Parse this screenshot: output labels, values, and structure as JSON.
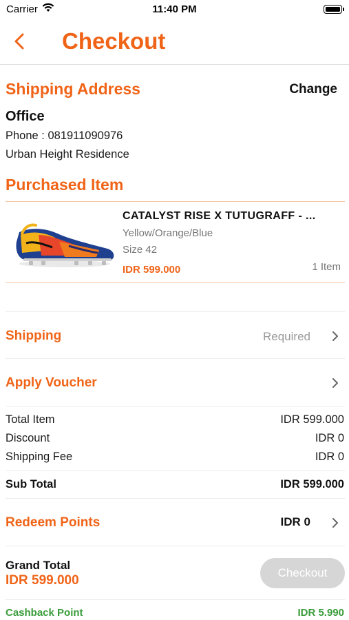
{
  "status_bar": {
    "carrier": "Carrier",
    "time": "11:40 PM",
    "icons": [
      "wifi-icon",
      "battery-icon"
    ]
  },
  "nav": {
    "title": "Checkout",
    "back_icon": "chevron-left-icon"
  },
  "colors": {
    "accent": "#f06418",
    "cashback": "#3a9c3a",
    "disabled_button": "#d6d6d6",
    "muted_text": "#9a9a9a"
  },
  "shipping_address": {
    "title": "Shipping Address",
    "change_label": "Change",
    "name": "Office",
    "phone": "Phone : 081911090976",
    "address": "Urban Height Residence"
  },
  "purchased_item": {
    "title": "Purchased Item",
    "name": "CATALYST RISE X TUTUGRAFF - ...",
    "variant": "Yellow/Orange/Blue",
    "size": "Size 42",
    "price": "IDR 599.000",
    "quantity": "1 Item"
  },
  "shipping": {
    "title": "Shipping",
    "hint": "Required",
    "icon": "chevron-right-icon"
  },
  "voucher": {
    "title": "Apply Voucher",
    "icon": "chevron-right-icon"
  },
  "summary": {
    "total_item_label": "Total Item",
    "total_item_value": "IDR 599.000",
    "discount_label": "Discount",
    "discount_value": "IDR 0",
    "shipping_fee_label": "Shipping Fee",
    "shipping_fee_value": "IDR 0",
    "sub_total_label": "Sub Total",
    "sub_total_value": "IDR 599.000"
  },
  "redeem_points": {
    "title": "Redeem Points",
    "value": "IDR 0",
    "icon": "chevron-right-icon"
  },
  "footer": {
    "grand_total_label": "Grand Total",
    "grand_total_value": "IDR 599.000",
    "checkout_label": "Checkout",
    "cashback_label": "Cashback Point",
    "cashback_value": "IDR 5.990"
  }
}
